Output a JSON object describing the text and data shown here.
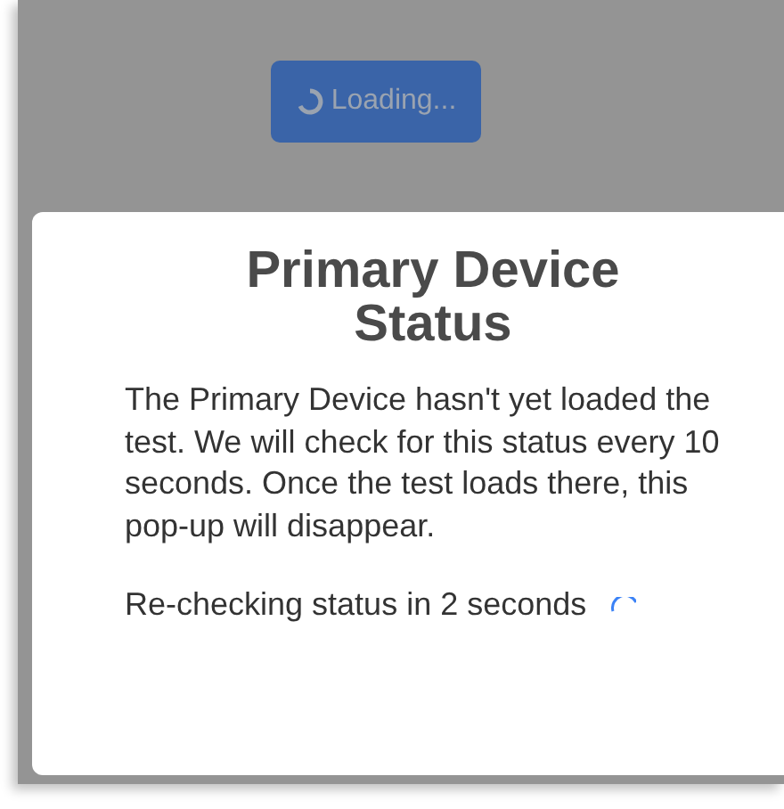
{
  "loading_button": {
    "label": "Loading..."
  },
  "dialog": {
    "title": "Primary Device Status",
    "message": "The Primary Device hasn't yet loaded the test. We will check for this status every 10 seconds. Once the test loads there, this pop-up will disappear.",
    "status": "Re-checking status in 2 seconds"
  }
}
